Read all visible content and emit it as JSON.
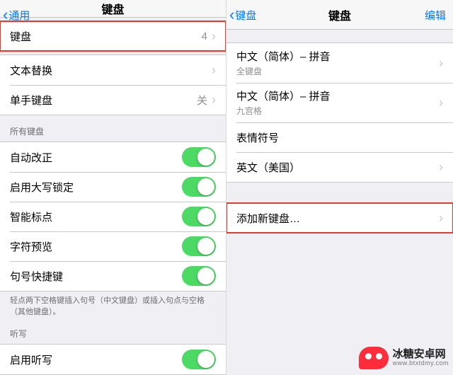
{
  "left": {
    "nav": {
      "back": "通用",
      "title": "键盘"
    },
    "keyboards_row": {
      "label": "键盘",
      "count": "4"
    },
    "rows": {
      "text_replace": "文本替换",
      "one_handed": {
        "label": "单手键盘",
        "value": "关"
      }
    },
    "section_all": "所有键盘",
    "toggles": {
      "auto_correct": "自动改正",
      "caps_lock": "启用大写锁定",
      "smart_punct": "智能标点",
      "char_preview": "字符预览",
      "period_shortcut": "句号快捷键"
    },
    "footer": "轻点两下空格键插入句号（中文键盘）或插入句点与空格（其他键盘）。",
    "section_dictation": "听写",
    "dictation_row": "启用听写"
  },
  "right": {
    "nav": {
      "back": "键盘",
      "title": "键盘",
      "edit": "编辑"
    },
    "keyboards": [
      {
        "label": "中文（简体）– 拼音",
        "sub": "全键盘"
      },
      {
        "label": "中文（简体）– 拼音",
        "sub": "九宫格"
      },
      {
        "label": "表情符号"
      },
      {
        "label": "英文（美国）"
      }
    ],
    "add_new": "添加新键盘…"
  },
  "watermark": {
    "line1": "冰糖安卓网",
    "line2": "www.btxtdmy.com"
  }
}
